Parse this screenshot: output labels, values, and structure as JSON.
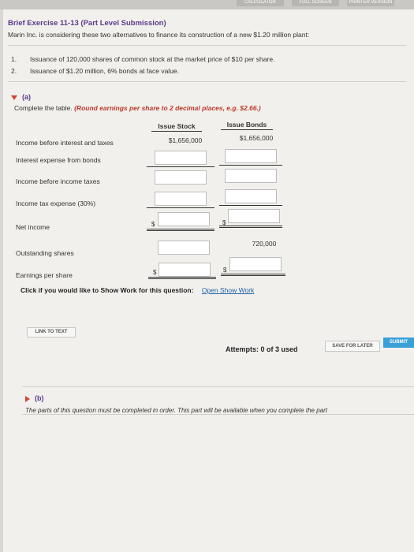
{
  "header": {
    "tabs": [
      "CALCULATOR",
      "FULL SCREEN",
      "PRINTER VERSION"
    ],
    "title": "Brief Exercise 11-13 (Part Level Submission)",
    "description": "Marin Inc. is considering these two alternatives to finance its construction of a new $1.20 million plant:"
  },
  "alternatives": [
    {
      "num": "1.",
      "text": "Issuance of 120,000 shares of common stock at the market price of $10 per share."
    },
    {
      "num": "2.",
      "text": "Issuance of $1.20 million, 6% bonds at face value."
    }
  ],
  "part_a": {
    "label": "(a)",
    "instruction_prefix": "Complete the table.",
    "instruction_red": "(Round earnings per share to 2 decimal places, e.g. $2.66.)",
    "col_stock": "Issue Stock",
    "col_bonds": "Issue Bonds",
    "rows": [
      {
        "label": "Income before interest and taxes",
        "stock": "$1,656,000",
        "bonds": "$1,656,000"
      },
      {
        "label": "Interest expense from bonds",
        "stock": "",
        "bonds": ""
      },
      {
        "label": "Income before income taxes",
        "stock": "",
        "bonds": ""
      },
      {
        "label": "Income tax expense (30%)",
        "stock": "",
        "bonds": ""
      },
      {
        "label": "Net income",
        "stock": "",
        "bonds": ""
      },
      {
        "label": "Outstanding shares",
        "stock": "",
        "bonds": "720,000"
      },
      {
        "label": "Earnings per share",
        "stock": "",
        "bonds": ""
      }
    ],
    "dollar": "$"
  },
  "show_work": {
    "question": "Click if you would like to Show Work for this question:",
    "link": "Open Show Work"
  },
  "buttons": {
    "link_to_text": "LINK TO TEXT",
    "attempts": "Attempts: 0 of 3 used",
    "save_later": "SAVE FOR LATER",
    "submit": "SUBMIT"
  },
  "part_b": {
    "label": "(b)",
    "note": "The parts of this question must be completed in order. This part will be available when you complete the part"
  }
}
